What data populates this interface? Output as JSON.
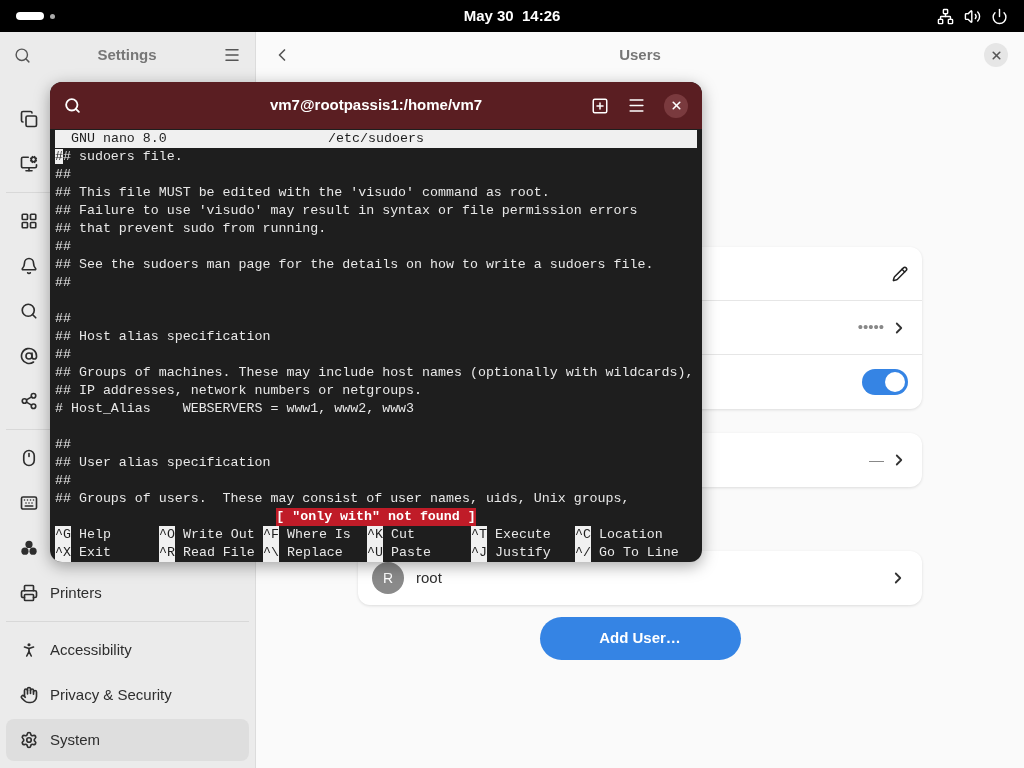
{
  "top_bar": {
    "clock": "May 30  14:26"
  },
  "sidebar": {
    "title": "Settings",
    "groups": [
      [
        {
          "selected": false
        },
        {
          "selected": false
        }
      ],
      [
        {
          "selected": false
        },
        {
          "selected": false
        },
        {
          "selected": false
        },
        {
          "selected": false
        },
        {
          "selected": false
        }
      ],
      [
        {
          "selected": false
        },
        {
          "selected": false
        },
        {
          "selected": false
        },
        {
          "label": "Printers",
          "selected": false
        }
      ],
      [
        {
          "label": "Accessibility",
          "selected": false
        },
        {
          "label": "Privacy & Security",
          "selected": false
        },
        {
          "label": "System",
          "selected": true
        }
      ]
    ]
  },
  "main": {
    "title": "Users",
    "cards": [
      [
        {
          "kind": "edit"
        },
        {
          "kind": "link",
          "value": "•••••"
        },
        {
          "kind": "switch",
          "on": true
        }
      ],
      [
        {
          "kind": "link",
          "value": "—"
        }
      ],
      [
        {
          "kind": "user",
          "initial": "R",
          "name": "root"
        }
      ]
    ],
    "add_button": "Add User…"
  },
  "terminal": {
    "title": "vm7@rootpassis1:/home/vm7",
    "nano_version": "GNU nano 8.0",
    "file": "/etc/sudoers",
    "lines": [
      {
        "text": "## sudoers file.",
        "cursor": true
      },
      {
        "text": "##",
        "cursor": false
      },
      {
        "text": "## This file MUST be edited with the 'visudo' command as root.",
        "cursor": false
      },
      {
        "text": "## Failure to use 'visudo' may result in syntax or file permission errors",
        "cursor": false
      },
      {
        "text": "## that prevent sudo from running.",
        "cursor": false
      },
      {
        "text": "##",
        "cursor": false
      },
      {
        "text": "## See the sudoers man page for the details on how to write a sudoers file.",
        "cursor": false
      },
      {
        "text": "##",
        "cursor": false
      },
      {
        "cursor": false
      },
      {
        "text": "##",
        "cursor": false
      },
      {
        "text": "## Host alias specification",
        "cursor": false
      },
      {
        "text": "##",
        "cursor": false
      },
      {
        "text": "## Groups of machines. These may include host names (optionally with wildcards),",
        "cursor": false
      },
      {
        "text": "## IP addresses, network numbers or netgroups.",
        "cursor": false
      },
      {
        "text": "# Host_Alias    WEBSERVERS = www1, www2, www3",
        "cursor": false
      },
      {
        "cursor": false
      },
      {
        "text": "##",
        "cursor": false
      },
      {
        "text": "## User alias specification",
        "cursor": false
      },
      {
        "text": "##",
        "cursor": false
      },
      {
        "text": "## Groups of users.  These may consist of user names, uids, Unix groups,",
        "cursor": false
      }
    ],
    "status": "[ \"only with\" not found ]",
    "shortcuts": [
      [
        {
          "key": "^G",
          "label": "Help"
        },
        {
          "key": "^O",
          "label": "Write Out"
        },
        {
          "key": "^F",
          "label": "Where Is"
        },
        {
          "key": "^K",
          "label": "Cut"
        },
        {
          "key": "^T",
          "label": "Execute"
        },
        {
          "key": "^C",
          "label": "Location"
        }
      ],
      [
        {
          "key": "^X",
          "label": "Exit"
        },
        {
          "key": "^R",
          "label": "Read File"
        },
        {
          "key": "^\\",
          "label": "Replace"
        },
        {
          "key": "^U",
          "label": "Paste"
        },
        {
          "key": "^J",
          "label": "Justify"
        },
        {
          "key": "^/",
          "label": "Go To Line"
        }
      ]
    ]
  }
}
